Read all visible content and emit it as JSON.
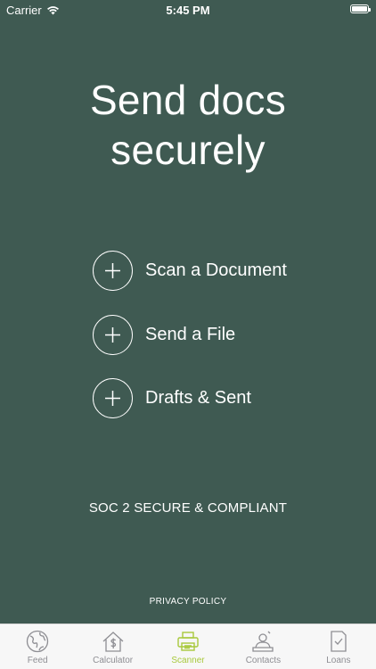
{
  "status_bar": {
    "carrier": "Carrier",
    "time": "5:45 PM",
    "battery_level": 1.0
  },
  "headline": {
    "line1": "Send docs",
    "line2": "securely"
  },
  "actions": [
    {
      "label": "Scan a Document",
      "icon": "plus-icon"
    },
    {
      "label": "Send a File",
      "icon": "plus-icon"
    },
    {
      "label": "Drafts & Sent",
      "icon": "plus-icon"
    }
  ],
  "compliance_text": "SOC 2 SECURE & COMPLIANT",
  "privacy_policy": "PRIVACY POLICY",
  "tabs": [
    {
      "label": "Feed",
      "icon": "globe-icon",
      "active": false
    },
    {
      "label": "Calculator",
      "icon": "house-dollar-icon",
      "active": false
    },
    {
      "label": "Scanner",
      "icon": "printer-icon",
      "active": true
    },
    {
      "label": "Contacts",
      "icon": "contact-person-icon",
      "active": false
    },
    {
      "label": "Loans",
      "icon": "document-check-icon",
      "active": false
    }
  ],
  "colors": {
    "background": "#3f5a52",
    "text": "#ffffff",
    "tab_active": "#a8c93c",
    "tab_inactive": "#8e8e93",
    "tab_bar_bg": "#f7f7f7"
  }
}
